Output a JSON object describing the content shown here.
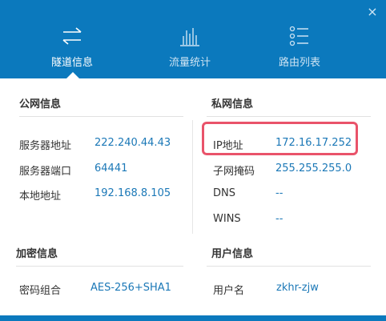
{
  "window": {
    "close_label": "×"
  },
  "tabs": [
    {
      "label": "隧道信息",
      "icon": "transfer-arrows-icon",
      "active": true
    },
    {
      "label": "流量统计",
      "icon": "bar-chart-icon",
      "active": false
    },
    {
      "label": "路由列表",
      "icon": "list-icon",
      "active": false
    }
  ],
  "public_network": {
    "title": "公网信息",
    "rows": [
      {
        "label": "服务器地址",
        "value": "222.240.44.43"
      },
      {
        "label": "服务器端口",
        "value": "64441"
      },
      {
        "label": "本地地址",
        "value": "192.168.8.105"
      }
    ]
  },
  "private_network": {
    "title": "私网信息",
    "rows": [
      {
        "label": "IP地址",
        "value": "172.16.17.252"
      },
      {
        "label": "子网掩码",
        "value": "255.255.255.0"
      },
      {
        "label": "DNS",
        "value": "--"
      },
      {
        "label": "WINS",
        "value": "--"
      }
    ]
  },
  "encryption": {
    "title": "加密信息",
    "rows": [
      {
        "label": "密码组合",
        "value": "AES-256+SHA1"
      }
    ]
  },
  "user": {
    "title": "用户信息",
    "rows": [
      {
        "label": "用户名",
        "value": "zkhr-zjw"
      }
    ]
  },
  "colors": {
    "header": "#0b79bd",
    "value": "#1b78b7",
    "highlight": "#e9536a"
  }
}
